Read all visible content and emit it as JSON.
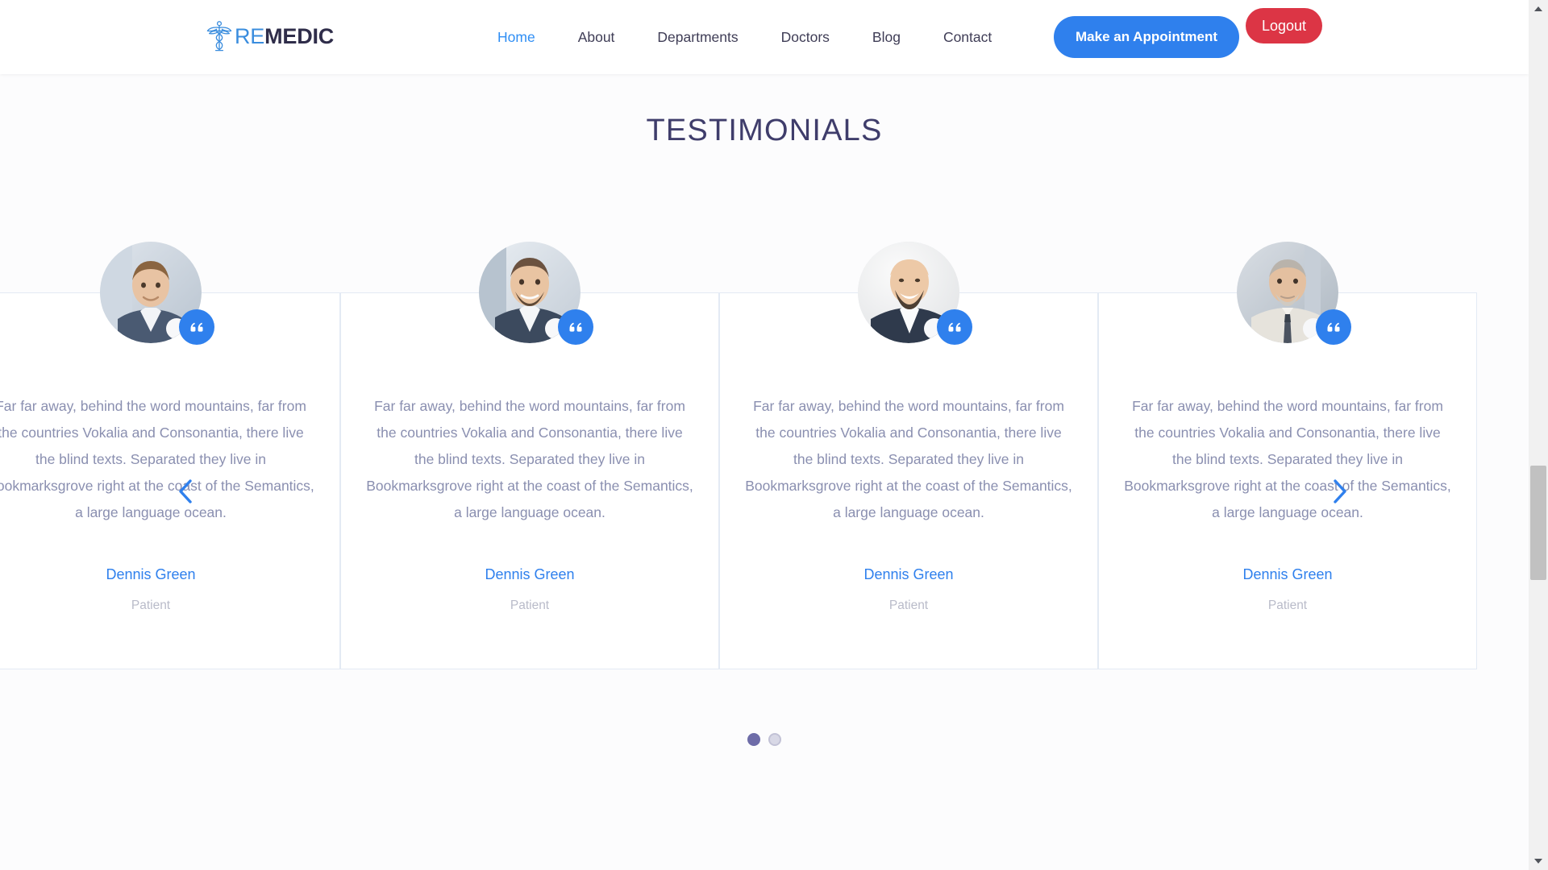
{
  "header": {
    "logo": {
      "icon": "caduceus-icon",
      "text_primary": "RE",
      "text_secondary": "MEDIC"
    },
    "nav": [
      {
        "label": "Home",
        "active": true
      },
      {
        "label": "About",
        "active": false
      },
      {
        "label": "Departments",
        "active": false
      },
      {
        "label": "Doctors",
        "active": false
      },
      {
        "label": "Blog",
        "active": false
      },
      {
        "label": "Contact",
        "active": false
      }
    ],
    "appointment_button": "Make an Appointment",
    "logout_button": "Logout"
  },
  "section": {
    "title": "TESTIMONIALS"
  },
  "carousel": {
    "prev_icon": "chevron-left-icon",
    "next_icon": "chevron-right-icon",
    "quote_icon": "quote-icon",
    "testimonials": [
      {
        "text": "Far far away, behind the word mountains, far from the countries Vokalia and Consonantia, there live the blind texts. Separated they live in Bookmarksgrove right at the coast of the Semantics, a large language ocean.",
        "name": "Dennis Green",
        "role": "Patient",
        "avatar": "avatar-man-coffee"
      },
      {
        "text": "Far far away, behind the word mountains, far from the countries Vokalia and Consonantia, there live the blind texts. Separated they live in Bookmarksgrove right at the coast of the Semantics, a large language ocean.",
        "name": "Dennis Green",
        "role": "Patient",
        "avatar": "avatar-man-beard"
      },
      {
        "text": "Far far away, behind the word mountains, far from the countries Vokalia and Consonantia, there live the blind texts. Separated they live in Bookmarksgrove right at the coast of the Semantics, a large language ocean.",
        "name": "Dennis Green",
        "role": "Patient",
        "avatar": "avatar-man-laughing"
      },
      {
        "text": "Far far away, behind the word mountains, far from the countries Vokalia and Consonantia, there live the blind texts. Separated they live in Bookmarksgrove right at the coast of the Semantics, a large language ocean.",
        "name": "Dennis Green",
        "role": "Patient",
        "avatar": "avatar-man-senior"
      }
    ],
    "dots": [
      {
        "active": true
      },
      {
        "active": false
      }
    ]
  },
  "colors": {
    "accent_blue": "#2f80ed",
    "link_blue": "#2f8ef4",
    "logout_red": "#dc3545",
    "heading_navy": "#3f3d6b",
    "body_text": "#8a8fb0",
    "role_text": "#b9bbc9",
    "card_border": "#e3eaf4",
    "page_background": "#fcfcfd",
    "dot_active": "#6e6ca8"
  }
}
